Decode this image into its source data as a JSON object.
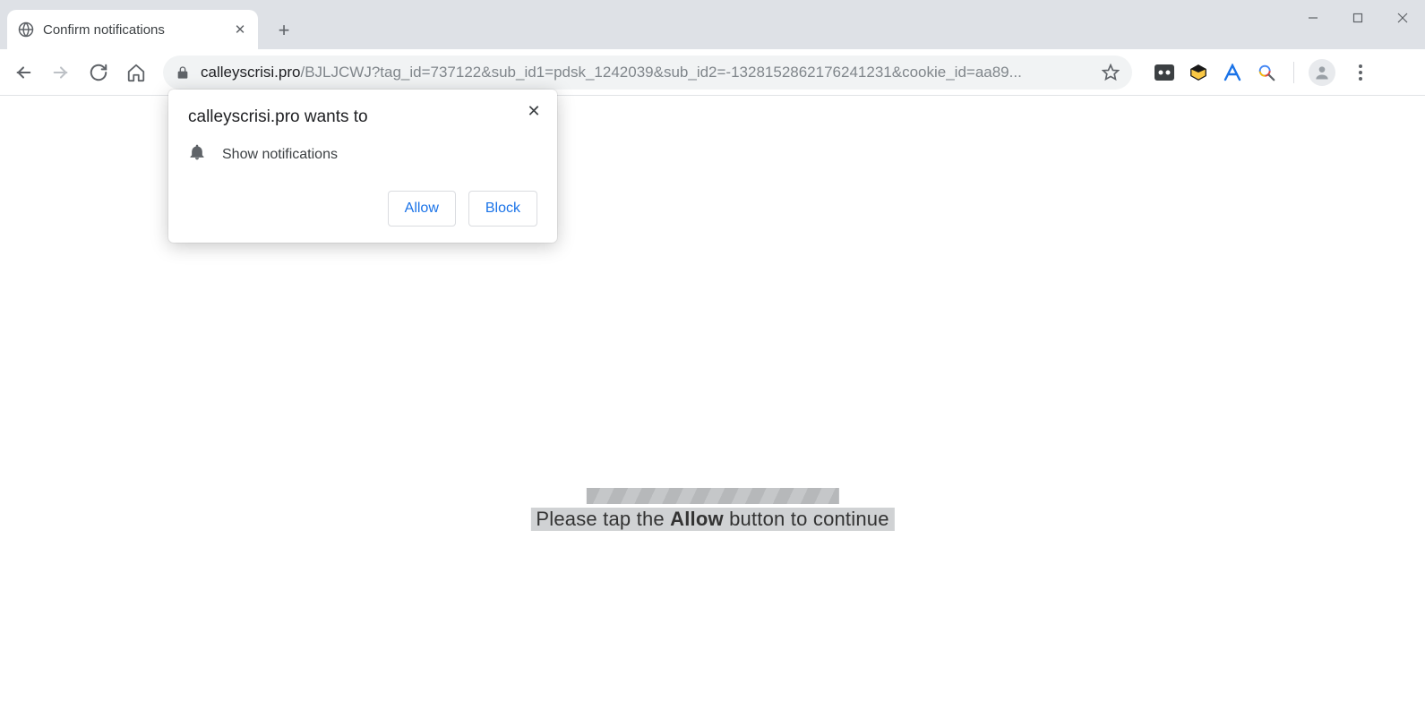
{
  "tab": {
    "title": "Confirm notifications"
  },
  "url": {
    "host": "calleyscrisi.pro",
    "path": "/BJLJCWJ?tag_id=737122&sub_id1=pdsk_1242039&sub_id2=-1328152862176241231&cookie_id=aa89..."
  },
  "popup": {
    "title": "calleyscrisi.pro wants to",
    "permission_text": "Show notifications",
    "allow_label": "Allow",
    "block_label": "Block"
  },
  "page": {
    "msg_prefix": "Please tap the ",
    "msg_bold": "Allow",
    "msg_suffix": " button to continue"
  }
}
